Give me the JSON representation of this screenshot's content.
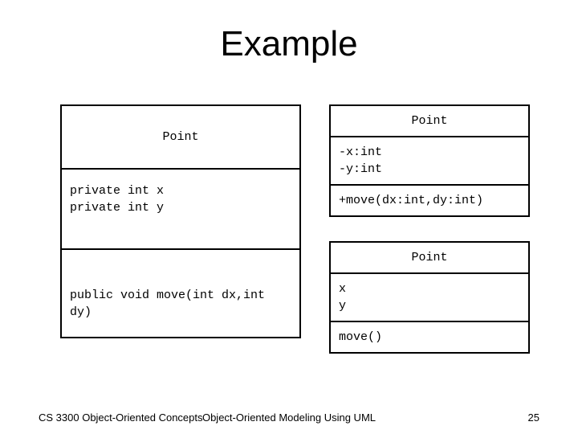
{
  "title": "Example",
  "boxLeft": {
    "name": "Point",
    "attrs_line1": "private int x",
    "attrs_line2": "private int y",
    "method": "public void move(int dx,int dy)"
  },
  "boxRightTop": {
    "name": "Point",
    "attrs_line1": "-x:int",
    "attrs_line2": "-y:int",
    "method": "+move(dx:int,dy:int)"
  },
  "boxRightBottom": {
    "name": "Point",
    "attrs_line1": "x",
    "attrs_line2": "y",
    "method": "move()"
  },
  "footer": {
    "left": "CS 3300 Object-Oriented Concepts",
    "center": "Object-Oriented Modeling Using UML",
    "right": "25"
  }
}
